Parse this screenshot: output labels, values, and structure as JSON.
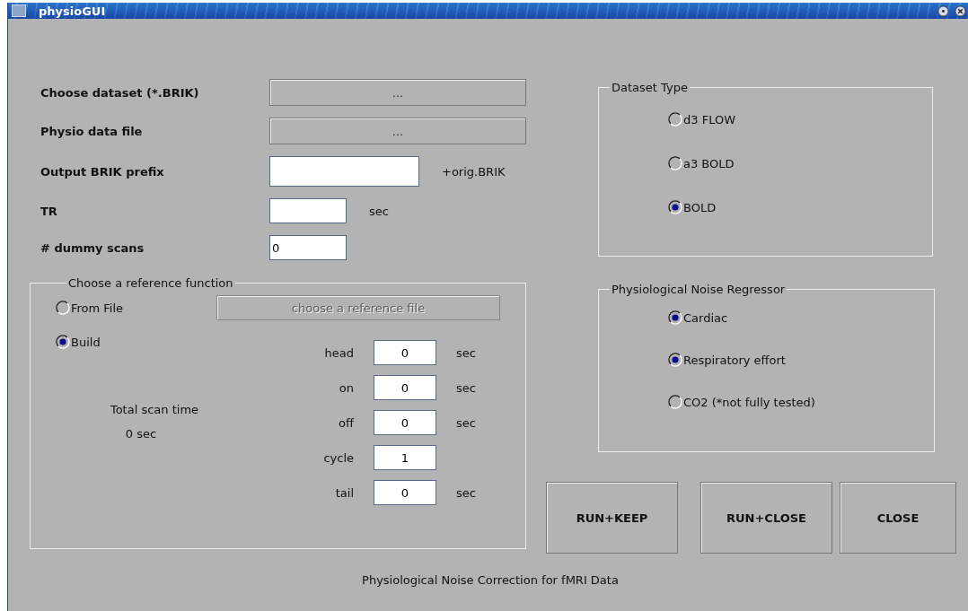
{
  "window": {
    "title": "physioGUI"
  },
  "inputs": [
    {
      "label": "Choose dataset (*.BRIK)",
      "kind": "browse",
      "text": "..."
    },
    {
      "label": "Physio data file",
      "kind": "browse",
      "text": "..."
    },
    {
      "label": "Output BRIK prefix",
      "kind": "prefix",
      "suffix": "+orig.BRIK"
    },
    {
      "label": "TR",
      "kind": "short",
      "suffix": "sec"
    },
    {
      "label": "#  dummy scans",
      "kind": "short",
      "value": "0"
    }
  ],
  "reference": {
    "title": "Choose a reference function",
    "options": [
      {
        "label": "From File",
        "selected": false
      },
      {
        "label": "Build",
        "selected": true
      }
    ],
    "file_button": {
      "label": "choose a reference file",
      "disabled": true
    },
    "total_label": "Total scan time",
    "total_value": "0 sec",
    "params": [
      {
        "label": "head",
        "value": "0",
        "unit": "sec"
      },
      {
        "label": "on",
        "value": "0",
        "unit": "sec"
      },
      {
        "label": "off",
        "value": "0",
        "unit": "sec"
      },
      {
        "label": "cycle",
        "value": "1"
      },
      {
        "label": "tail",
        "value": "0",
        "unit": "sec"
      }
    ]
  },
  "dataset_type": {
    "title": "Dataset Type",
    "options": [
      {
        "label": "d3 FLOW",
        "selected": false
      },
      {
        "label": "a3 BOLD",
        "selected": false
      },
      {
        "label": "BOLD",
        "selected": true
      }
    ]
  },
  "noise_regressor": {
    "title": "Physiological Noise Regressor",
    "options": [
      {
        "label": "Cardiac",
        "checked": true
      },
      {
        "label": "Respiratory effort",
        "checked": true
      },
      {
        "label": "CO2 (*not fully tested)",
        "checked": false
      }
    ]
  },
  "actions": [
    "RUN+KEEP",
    "RUN+CLOSE",
    "CLOSE"
  ],
  "footer": "Physiological Noise Correction for fMRI Data"
}
